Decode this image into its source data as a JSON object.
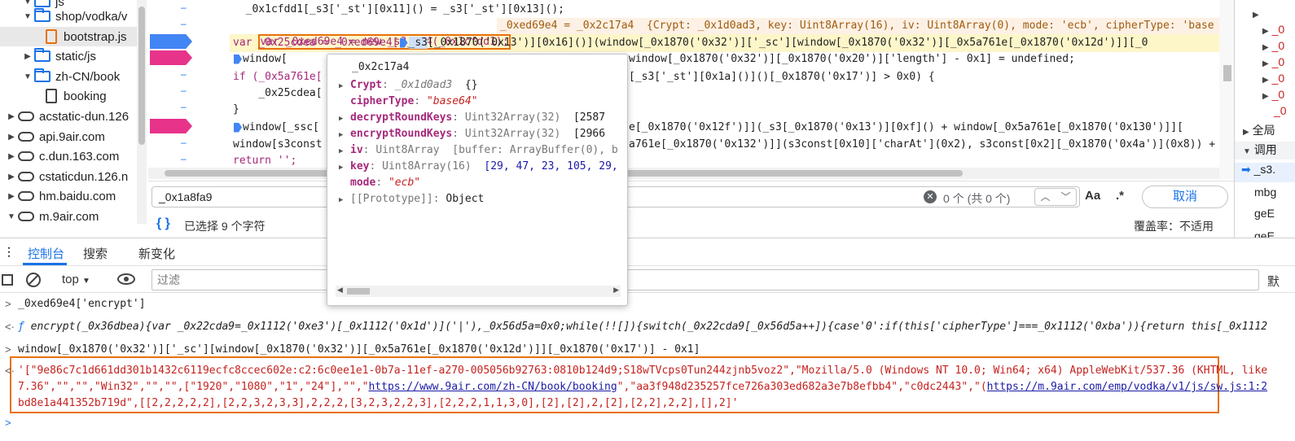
{
  "file_tree": {
    "items": [
      {
        "label": "js",
        "type": "folder",
        "expanded": true,
        "indent": 2
      },
      {
        "label": "shop/vodka/v",
        "type": "folder",
        "expanded": true,
        "indent": 2
      },
      {
        "label": "bootstrap.js",
        "type": "file",
        "indent": 4,
        "selected": true
      },
      {
        "label": "static/js",
        "type": "folder",
        "expanded": false,
        "indent": 2
      },
      {
        "label": "zh-CN/book",
        "type": "folder",
        "expanded": true,
        "indent": 2
      },
      {
        "label": "booking",
        "type": "file",
        "indent": 4
      },
      {
        "label": "acstatic-dun.126",
        "type": "cloud",
        "indent": 1
      },
      {
        "label": "api.9air.com",
        "type": "cloud",
        "indent": 1
      },
      {
        "label": "c.dun.163.com",
        "type": "cloud",
        "indent": 1
      },
      {
        "label": "cstaticdun.126.n",
        "type": "cloud",
        "indent": 1
      },
      {
        "label": "hm.baidu.com",
        "type": "cloud",
        "indent": 1
      },
      {
        "label": "m.9air.com",
        "type": "cloud",
        "indent": 1,
        "expanded": true
      }
    ]
  },
  "code": {
    "line1": "  _0x1cfdd1[_s3['_st'][0x11]() = _s3['_st'][0x13]();",
    "line2_var": "var _0xed69e4 = new _s3_es4(_0x1cfdd1);",
    "line2_inline": "_0xed69e4 = _0x2c17a4  {Crypt: _0x1d0ad3, key: Uint8Array(16), iv: Uint8Array(0), mode: 'ecb', cipherType: 'base",
    "line3": "var _0x25cdea = _0xed69e4[",
    "line3_sel": "_s3",
    "line3_rest": "[_0x1870('0x13')][0x16]()](window[_0x1870('0x32')]['_sc'][window[_0x1870('0x32')][_0x5a761e[_0x1870('0x12d')]][_0",
    "line4": "window[_0x1870('0x32')][_0x1870('0x20')]['length'] - 0x1] = undefined;",
    "line4_prefix": "window[",
    "line5": "if (_0x5a761e[",
    "line5_rest": "[_s3['_st'][0x1a]()]()[_0x1870('0x17')] > 0x0) {",
    "line6": "    _0x25cdea[",
    "line7": "}",
    "line8": "window[_ssc[",
    "line8_rest": "e[_0x1870('0x12f')]](_s3[_0x1870('0x13')][0xf]() + window[_0x5a761e[_0x1870('0x130')]][",
    "line9": "window[s3const",
    "line9_rest": "a761e[_0x1870('0x132')]](s3const[0x10]['charAt'](0x2), s3const[0x2][_0x1870('0x4a')](0x8)) + s",
    "line10": "return '';"
  },
  "search": {
    "value": "_0x1a8fa9",
    "match_count": "0 个 (共 0 个)",
    "case_label": "Aa",
    "regex_label": ".*",
    "cancel_label": "取消"
  },
  "status": {
    "selection": "已选择 9 个字符",
    "coverage": "覆盖率：不适用"
  },
  "right_panel": {
    "rows": [
      "",
      "_0",
      "_0",
      "_0",
      "_0",
      "_0",
      "_0",
      "_0"
    ],
    "scope_label": "全局",
    "callstack_label": "调用",
    "frames": [
      "_s3.",
      "mbg",
      "geE",
      "geE"
    ]
  },
  "drawer": {
    "tabs": [
      "控制台",
      "搜索",
      "新变化"
    ],
    "context": "top",
    "filter_placeholder": "过滤",
    "right_label": "默"
  },
  "console": {
    "line1": "_0xed69e4['encrypt']",
    "line2": "encrypt(_0x36dbea){var _0x22cda9=_0x1112('0xe3')[_0x1112('0x1d')]('|'),_0x56d5a=0x0;while(!![]){switch(_0x22cda9[_0x56d5a++]){case'0':if(this['cipherType']===_0x1112('0xba')){return this[_0x1112",
    "line3": "window[_0x1870('0x32')]['_sc'][window[_0x1870('0x32')][_0x5a761e[_0x1870('0x12d')]][_0x1870('0x17')] - 0x1]",
    "result1": "'[\"9e86c7c1d661dd301b1432c6119ecfc8ccec602e:c2:6c0ee1e1-0b7a-11ef-a270-005056b92763:0810b124d9;S18wTVcps0Tun244zjnb5voz2\",\"Mozilla/5.0 (Windows NT 10.0; Win64; x64) AppleWebKit/537.36 (KHTML, like",
    "result2_a": "7.36\",\"\",\"\",\"Win32\",\"\",\"\",[\"1920\",\"1080\",\"1\",\"24\"],\"\",\"",
    "result2_link1": "https://www.9air.com/zh-CN/book/booking",
    "result2_b": "\",\"aa3f948d235257fce726a303ed682a3e7b8efbb4\",\"c0dc2443\",\"(",
    "result2_link2": "https://m.9air.com/emp/vodka/v1/js/sw.js:1:2",
    "result3": "bd8e1a441352b719d\",[[2,2,2,2,2],[2,2,3,2,3,3],2,2,2,[3,2,3,2,2,3],[2,2,2,1,1,3,0],[2],[2],2,[2],[2,2],2,2],[],2]'"
  },
  "popover": {
    "title": "_0x2c17a4",
    "rows": [
      {
        "key": "Crypt",
        "type": "_0x1d0ad3",
        "value": "{}",
        "expandable": true
      },
      {
        "key": "cipherType",
        "value": "\"base64\"",
        "kind": "string"
      },
      {
        "key": "decryptRoundKeys",
        "type": "Uint32Array(32)",
        "value": "[2587",
        "expandable": true
      },
      {
        "key": "encryptRoundKeys",
        "type": "Uint32Array(32)",
        "value": "[2966",
        "expandable": true
      },
      {
        "key": "iv",
        "type": "Uint8Array",
        "value": "[buffer: ArrayBuffer(0), b",
        "expandable": true
      },
      {
        "key": "key",
        "type": "Uint8Array(16)",
        "value": "[29, 47, 23, 105, 29,",
        "expandable": true
      },
      {
        "key": "mode",
        "value": "\"ecb\"",
        "kind": "string"
      },
      {
        "key": "[[Prototype]]",
        "value": "Object",
        "expandable": true,
        "proto": true
      }
    ]
  }
}
